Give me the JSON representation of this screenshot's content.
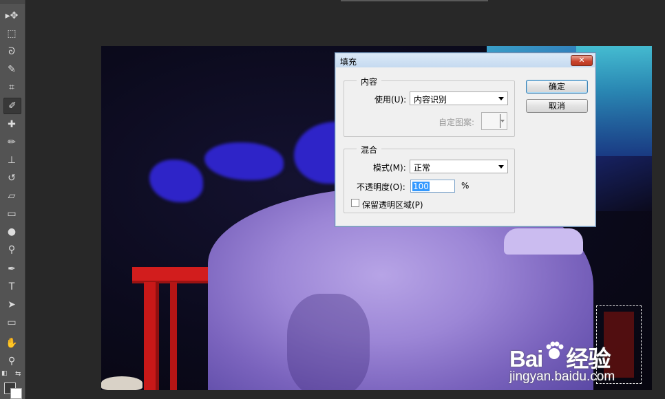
{
  "toolbar": {
    "tools": [
      {
        "icon": "move-tool-icon",
        "glyph": "▸✥"
      },
      {
        "icon": "marquee-tool-icon",
        "glyph": "⬚"
      },
      {
        "icon": "lasso-tool-icon",
        "glyph": "ᘐ"
      },
      {
        "icon": "quick-selection-tool-icon",
        "glyph": "✎"
      },
      {
        "icon": "crop-tool-icon",
        "glyph": "⌗"
      },
      {
        "icon": "eyedropper-tool-icon",
        "glyph": "✐"
      },
      {
        "icon": "healing-brush-tool-icon",
        "glyph": "✚"
      },
      {
        "icon": "brush-tool-icon",
        "glyph": "✏"
      },
      {
        "icon": "clone-stamp-tool-icon",
        "glyph": "⊥"
      },
      {
        "icon": "history-brush-tool-icon",
        "glyph": "↺"
      },
      {
        "icon": "eraser-tool-icon",
        "glyph": "▱"
      },
      {
        "icon": "gradient-tool-icon",
        "glyph": "▭"
      },
      {
        "icon": "blur-tool-icon",
        "glyph": "●"
      },
      {
        "icon": "dodge-tool-icon",
        "glyph": "⚲"
      },
      {
        "icon": "pen-tool-icon",
        "glyph": "✒"
      },
      {
        "icon": "type-tool-icon",
        "glyph": "T"
      },
      {
        "icon": "path-selection-tool-icon",
        "glyph": "➤"
      },
      {
        "icon": "rectangle-tool-icon",
        "glyph": "▭"
      },
      {
        "icon": "hand-tool-icon",
        "glyph": "✋"
      },
      {
        "icon": "zoom-tool-icon",
        "glyph": "⚲"
      }
    ]
  },
  "colors": {
    "foreground": "#3a3a3a",
    "background": "#ffffff"
  },
  "dialog": {
    "title": "填充",
    "close_label": "✕",
    "contents_group": {
      "label": "内容",
      "use_label": "使用(U):",
      "use_value": "内容识别",
      "custom_pattern_label": "自定图案:"
    },
    "blending_group": {
      "label": "混合",
      "mode_label": "模式(M):",
      "mode_value": "正常",
      "opacity_label": "不透明度(O):",
      "opacity_value": "100",
      "opacity_unit": "%",
      "preserve_transparency_label": "保留透明区域(P)",
      "preserve_transparency_checked": false
    },
    "ok_label": "确定",
    "cancel_label": "取消"
  },
  "watermark": {
    "logo_left": "Bai",
    "logo_right": "经验",
    "url": "jingyan.baidu.com"
  }
}
